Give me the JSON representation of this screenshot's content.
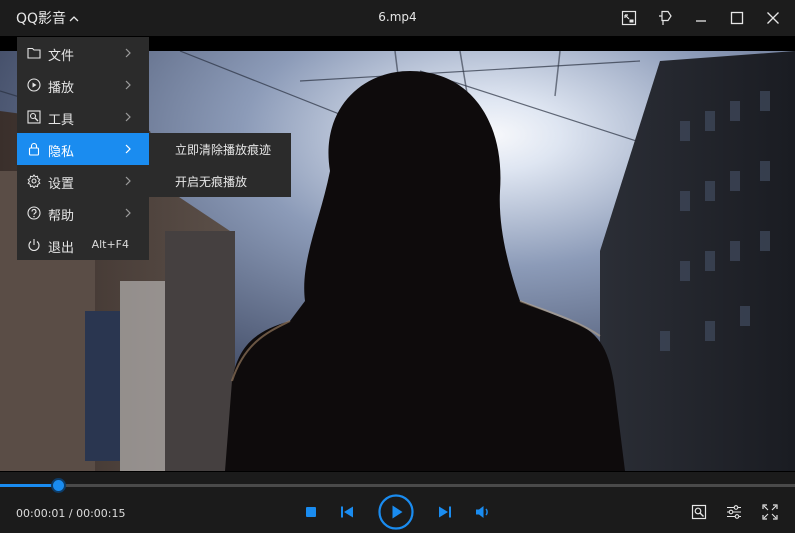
{
  "app": {
    "name": "QQ影音",
    "file_title": "6.mp4"
  },
  "menu": {
    "items": [
      {
        "label": "文件",
        "icon": "folder-icon",
        "has_submenu": true
      },
      {
        "label": "播放",
        "icon": "play-circle-icon",
        "has_submenu": true
      },
      {
        "label": "工具",
        "icon": "tools-icon",
        "has_submenu": true
      },
      {
        "label": "隐私",
        "icon": "lock-icon",
        "has_submenu": true,
        "active": true
      },
      {
        "label": "设置",
        "icon": "gear-icon",
        "has_submenu": true
      },
      {
        "label": "帮助",
        "icon": "help-icon",
        "has_submenu": true
      },
      {
        "label": "退出",
        "icon": "power-icon",
        "shortcut": "Alt+F4"
      }
    ]
  },
  "submenu": {
    "items": [
      {
        "label": "立即清除播放痕迹"
      },
      {
        "label": "开启无痕播放"
      }
    ]
  },
  "player": {
    "current_time": "00:00:01",
    "total_time": "00:00:15",
    "time_display": "00:00:01 / 00:00:15",
    "progress_fraction": 0.073
  },
  "colors": {
    "accent": "#1a8cf0",
    "menu_bg": "#2b2b2b",
    "titlebar_bg": "#1c1c1c"
  }
}
